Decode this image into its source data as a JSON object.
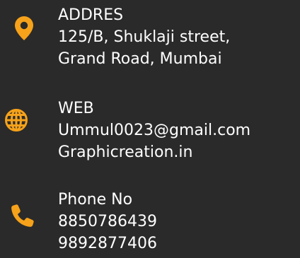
{
  "accent_color": "#f6a21a",
  "background_color": "#2a2a2a",
  "address": {
    "icon": "location-pin-icon",
    "label": "ADDRES",
    "line1": "125/B, Shuklaji street,",
    "line2": "Grand Road, Mumbai"
  },
  "web": {
    "icon": "globe-icon",
    "label": "WEB",
    "line1": "Ummul0023@gmail.com",
    "line2": "Graphicreation.in"
  },
  "phone": {
    "icon": "phone-icon",
    "label": "Phone No",
    "line1": "8850786439",
    "line2": "9892877406"
  }
}
